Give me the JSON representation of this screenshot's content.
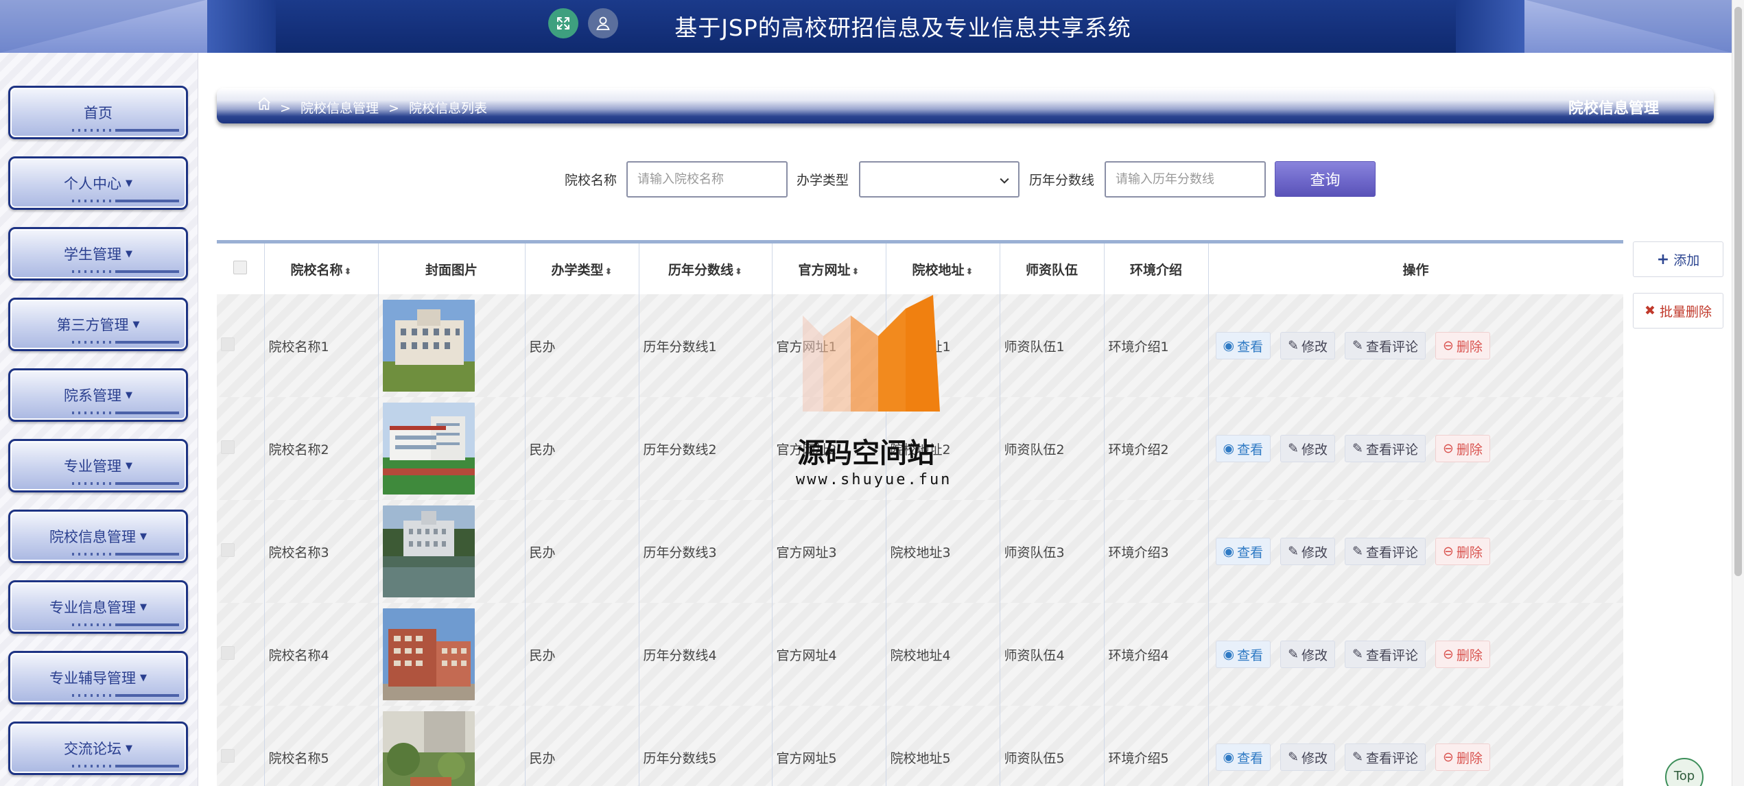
{
  "app": {
    "title": "基于JSP的高校研招信息及专业信息共享系统"
  },
  "header": {
    "icons": [
      "expand-icon",
      "user-icon"
    ]
  },
  "sidebar": {
    "items": [
      {
        "label": "首页",
        "has_caret": false
      },
      {
        "label": "个人中心",
        "has_caret": true
      },
      {
        "label": "学生管理",
        "has_caret": true
      },
      {
        "label": "第三方管理",
        "has_caret": true
      },
      {
        "label": "院系管理",
        "has_caret": true
      },
      {
        "label": "专业管理",
        "has_caret": true
      },
      {
        "label": "院校信息管理",
        "has_caret": true
      },
      {
        "label": "专业信息管理",
        "has_caret": true
      },
      {
        "label": "专业辅导管理",
        "has_caret": true
      },
      {
        "label": "交流论坛",
        "has_caret": true
      }
    ]
  },
  "breadcrumb": {
    "sep": ">",
    "items": [
      "院校信息管理",
      "院校信息列表"
    ],
    "right_title": "院校信息管理"
  },
  "search": {
    "name_label": "院校名称",
    "name_placeholder": "请输入院校名称",
    "type_label": "办学类型",
    "type_value": "",
    "score_label": "历年分数线",
    "score_placeholder": "请输入历年分数线",
    "query_label": "查询"
  },
  "actions": {
    "add_label": "添加",
    "batch_delete_label": "批量删除"
  },
  "table": {
    "headers": {
      "name": "院校名称",
      "cover": "封面图片",
      "type": "办学类型",
      "score": "历年分数线",
      "website": "官方网址",
      "address": "院校地址",
      "faculty": "师资队伍",
      "environment": "环境介绍",
      "ops": "操作"
    },
    "op_labels": {
      "view": "查看",
      "edit": "修改",
      "comment": "查看评论",
      "delete": "删除"
    },
    "rows": [
      {
        "name": "院校名称1",
        "type": "民办",
        "score": "历年分数线1",
        "website": "官方网址1",
        "address": "院校地址1",
        "faculty": "师资队伍1",
        "environment": "环境介绍1"
      },
      {
        "name": "院校名称2",
        "type": "民办",
        "score": "历年分数线2",
        "website": "官方网址2",
        "address": "院校地址2",
        "faculty": "师资队伍2",
        "environment": "环境介绍2"
      },
      {
        "name": "院校名称3",
        "type": "民办",
        "score": "历年分数线3",
        "website": "官方网址3",
        "address": "院校地址3",
        "faculty": "师资队伍3",
        "environment": "环境介绍3"
      },
      {
        "name": "院校名称4",
        "type": "民办",
        "score": "历年分数线4",
        "website": "官方网址4",
        "address": "院校地址4",
        "faculty": "师资队伍4",
        "environment": "环境介绍4"
      },
      {
        "name": "院校名称5",
        "type": "民办",
        "score": "历年分数线5",
        "website": "官方网址5",
        "address": "院校地址5",
        "faculty": "师资队伍5",
        "environment": "环境介绍5"
      }
    ]
  },
  "watermark": {
    "text": "源码空间站",
    "url": "www.shuyue.fun"
  },
  "top_button": {
    "label": "Top"
  },
  "colors": {
    "brand_dark": "#1b3a8a",
    "query_button": "#6c65c8",
    "delete_red": "#d9534f",
    "view_blue": "#2f7ac4"
  }
}
